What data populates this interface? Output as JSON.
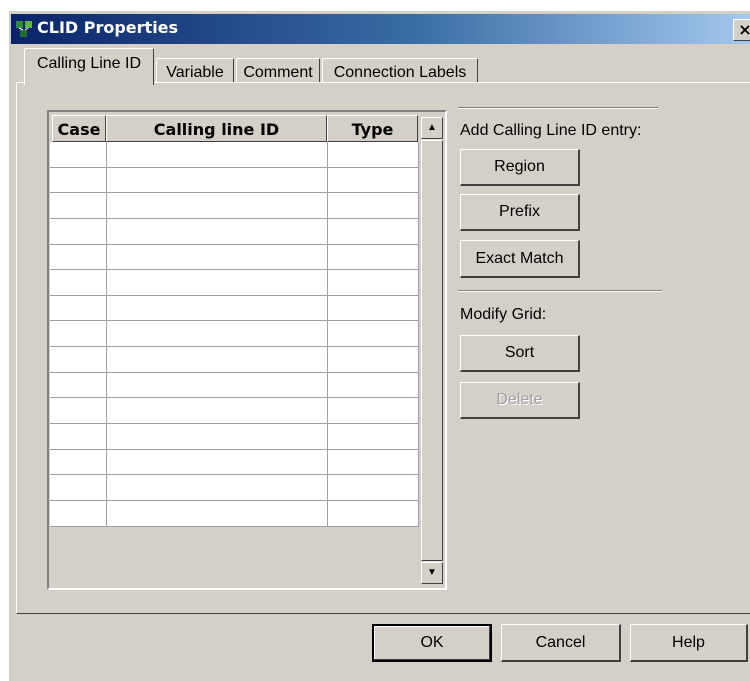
{
  "window": {
    "title": "CLID Properties",
    "close_label": "×"
  },
  "tabs": [
    {
      "label": "Calling Line ID",
      "active": true
    },
    {
      "label": "Variable",
      "active": false
    },
    {
      "label": "Comment",
      "active": false
    },
    {
      "label": "Connection Labels",
      "active": false
    }
  ],
  "grid": {
    "columns": [
      "Case",
      "Calling line ID",
      "Type"
    ],
    "rows": [
      [
        "",
        "",
        ""
      ],
      [
        "",
        "",
        ""
      ],
      [
        "",
        "",
        ""
      ],
      [
        "",
        "",
        ""
      ],
      [
        "",
        "",
        ""
      ],
      [
        "",
        "",
        ""
      ],
      [
        "",
        "",
        ""
      ],
      [
        "",
        "",
        ""
      ],
      [
        "",
        "",
        ""
      ],
      [
        "",
        "",
        ""
      ],
      [
        "",
        "",
        ""
      ],
      [
        "",
        "",
        ""
      ],
      [
        "",
        "",
        ""
      ],
      [
        "",
        "",
        ""
      ],
      [
        "",
        "",
        ""
      ]
    ]
  },
  "add_section": {
    "label": "Add Calling Line ID entry:",
    "region_label": "Region",
    "prefix_label": "Prefix",
    "exact_match_label": "Exact Match"
  },
  "modify_section": {
    "label": "Modify Grid:",
    "sort_label": "Sort",
    "delete_label": "Delete"
  },
  "footer": {
    "ok_label": "OK",
    "cancel_label": "Cancel",
    "help_label": "Help"
  }
}
